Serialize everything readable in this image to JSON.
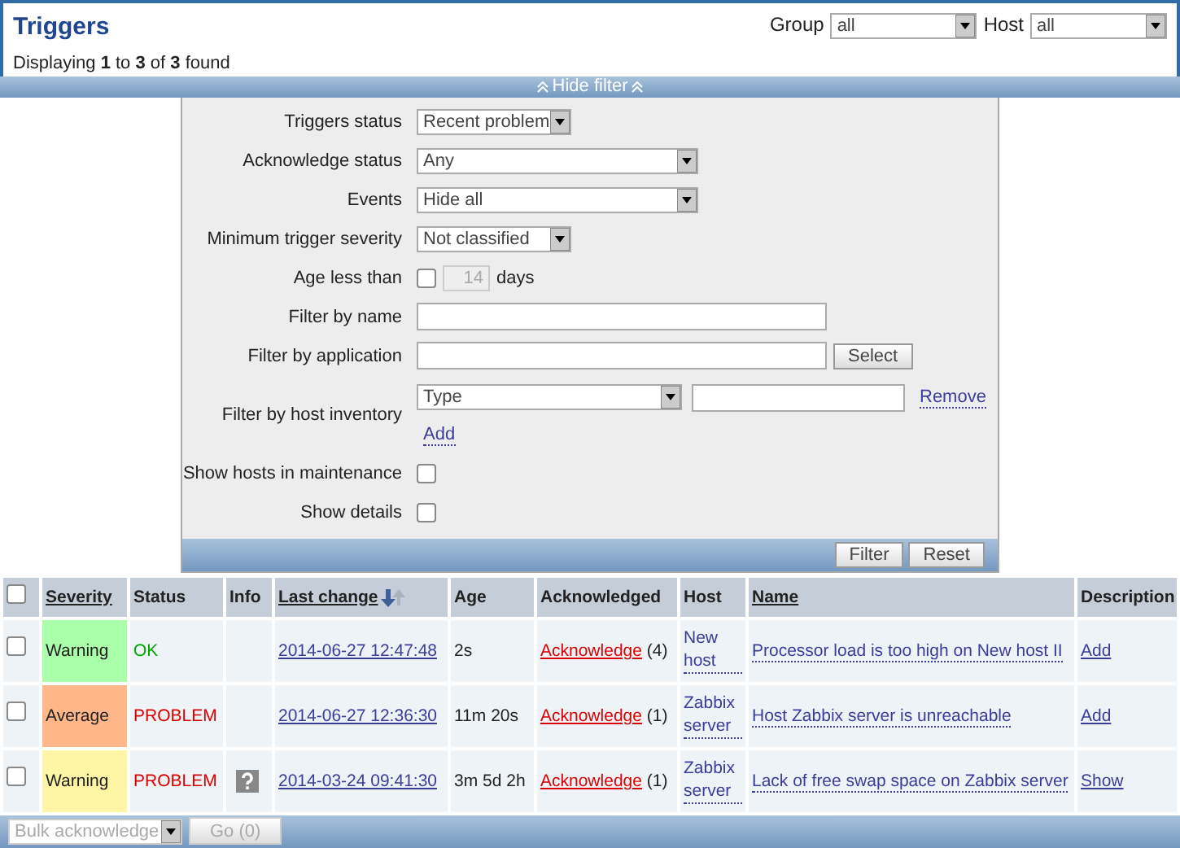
{
  "header": {
    "title": "Triggers",
    "summary": "Displaying **1** to **3** of **3** found",
    "selects": [
      {
        "label": "Group",
        "value": "all"
      },
      {
        "label": "Host",
        "value": "all"
      }
    ]
  },
  "filter_toggle": {
    "label": "Hide filter",
    "expanded": true
  },
  "filter": {
    "rows": [
      {
        "kind": "select",
        "label": "Triggers status",
        "value": "Recent problem",
        "wide": false
      },
      {
        "kind": "select",
        "label": "Acknowledge status",
        "value": "Any",
        "wide": true
      },
      {
        "kind": "select",
        "label": "Events",
        "value": "Hide all",
        "wide": true
      },
      {
        "kind": "select",
        "label": "Minimum trigger severity",
        "value": "Not classified",
        "wide": false
      },
      {
        "kind": "age",
        "label": "Age less than",
        "checked": false,
        "value": "14",
        "disabled": true,
        "unit": "days"
      },
      {
        "kind": "text",
        "label": "Filter by name"
      },
      {
        "kind": "text_button",
        "label": "Filter by application",
        "button": "Select"
      },
      {
        "kind": "inventory",
        "label": "Filter by host inventory",
        "field": "Type",
        "remove": "Remove",
        "add": "Add"
      },
      {
        "kind": "checkbox",
        "label": "Show hosts in maintenance",
        "checked": false
      },
      {
        "kind": "checkbox",
        "label": "Show details",
        "checked": false
      }
    ],
    "buttons": [
      "Filter",
      "Reset"
    ]
  },
  "table": {
    "all_checked": false,
    "columns": [
      {
        "label": "Severity",
        "sortable": true,
        "sorted": false
      },
      {
        "label": "Status",
        "sortable": false
      },
      {
        "label": "Info",
        "sortable": false
      },
      {
        "label": "Last change",
        "sortable": true,
        "sorted": true
      },
      {
        "label": "Age",
        "sortable": false
      },
      {
        "label": "Acknowledged",
        "sortable": false
      },
      {
        "label": "Host",
        "sortable": false
      },
      {
        "label": "Name",
        "sortable": true,
        "sorted": false
      },
      {
        "label": "Description",
        "sortable": false
      }
    ],
    "rows": [
      {
        "checked": false,
        "severity": "Warning",
        "color": "#aaffaa",
        "status": "OK",
        "problem": false,
        "info": false,
        "last_change": "2014-06-27 12:47:48",
        "age": "2s",
        "ack": "Acknowledge",
        "ack_count": "(4)",
        "host": "New host",
        "name": "Processor load is too high on New host II",
        "description": "Add"
      },
      {
        "checked": false,
        "severity": "Average",
        "color": "#ffb689",
        "status": "PROBLEM",
        "problem": true,
        "info": false,
        "last_change": "2014-06-27 12:36:30",
        "age": "11m 20s",
        "ack": "Acknowledge",
        "ack_count": "(1)",
        "host": "Zabbix server",
        "name": "Host Zabbix server is unreachable",
        "description": "Add"
      },
      {
        "checked": false,
        "severity": "Warning",
        "color": "#fff6a5",
        "status": "PROBLEM",
        "problem": true,
        "info": true,
        "last_change": "2014-03-24 09:41:30",
        "age": "3m 5d 2h",
        "ack": "Acknowledge",
        "ack_count": "(1)",
        "host": "Zabbix server",
        "name": "Lack of free swap space on Zabbix server",
        "description": "Show"
      }
    ]
  },
  "footer": {
    "action": "Bulk acknowledge",
    "go": "Go (0)",
    "disabled": true
  }
}
